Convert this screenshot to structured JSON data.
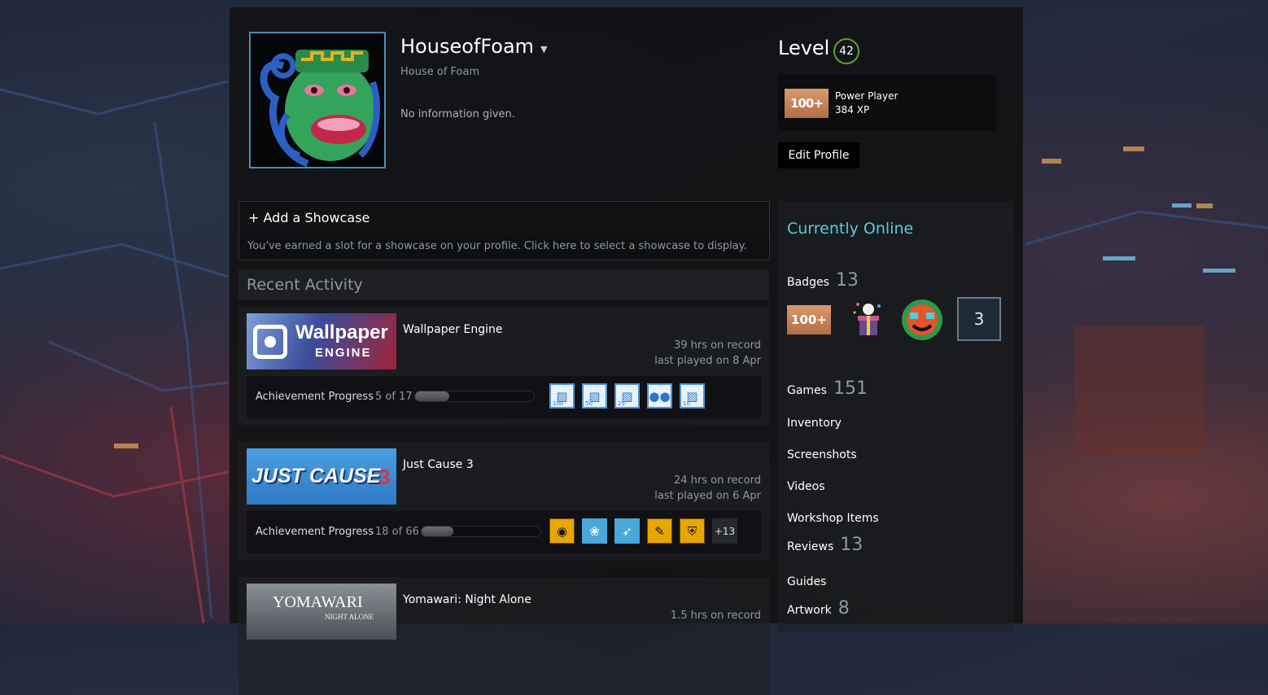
{
  "profile": {
    "persona_name": "HouseofFoam",
    "real_name": "House of Foam",
    "summary": "No information given.",
    "level_label": "Level",
    "level": "42",
    "favorite_badge": {
      "icon_text": "100+",
      "name": "Power Player",
      "xp": "384 XP"
    },
    "edit_profile_label": "Edit Profile"
  },
  "showcase": {
    "title": "+ Add a Showcase",
    "description": "You've earned a slot for a showcase on your profile. Click here to select a showcase to display."
  },
  "recent_activity": {
    "title": "Recent Activity",
    "achievement_label": "Achievement Progress",
    "games": [
      {
        "name": "Wallpaper Engine",
        "capsule_line1": "Wallpaper",
        "capsule_line2": "ENGINE",
        "hours": "39 hrs on record",
        "last_played": "last played on 8 Apr",
        "ach_count": "5 of 17",
        "ach_progress": 0.29,
        "icons": [
          {
            "name": "landscape-icon",
            "glyph": "▨",
            "num": "100"
          },
          {
            "name": "image-icon",
            "glyph": "▨",
            "num": "50"
          },
          {
            "name": "image-icon",
            "glyph": "▨",
            "num": "25"
          },
          {
            "name": "users-icon",
            "glyph": "●●",
            "num": ""
          },
          {
            "name": "image-icon",
            "glyph": "▨",
            "num": "10"
          }
        ]
      },
      {
        "name": "Just Cause 3",
        "capsule_text": "JUST CAUSE",
        "capsule_num": "3",
        "hours": "24 hrs on record",
        "last_played": "last played on 6 Apr",
        "ach_count": "18 of 66",
        "ach_progress": 0.27,
        "more": "+13"
      },
      {
        "name": "Yomawari: Night Alone",
        "capsule_text": "YOMAWARI",
        "capsule_sub": "NIGHT ALONE",
        "hours": "1.5 hrs on record"
      }
    ]
  },
  "sidebar": {
    "status": "Currently Online",
    "badges": {
      "label": "Badges",
      "count": "13",
      "badge1_text": "100+",
      "badge4_text": "3"
    },
    "games": {
      "label": "Games",
      "count": "151"
    },
    "inventory": "Inventory",
    "screenshots": "Screenshots",
    "videos": "Videos",
    "workshop": "Workshop Items",
    "reviews": {
      "label": "Reviews",
      "count": "13"
    },
    "guides": "Guides",
    "artwork": {
      "label": "Artwork",
      "count": "8"
    }
  }
}
